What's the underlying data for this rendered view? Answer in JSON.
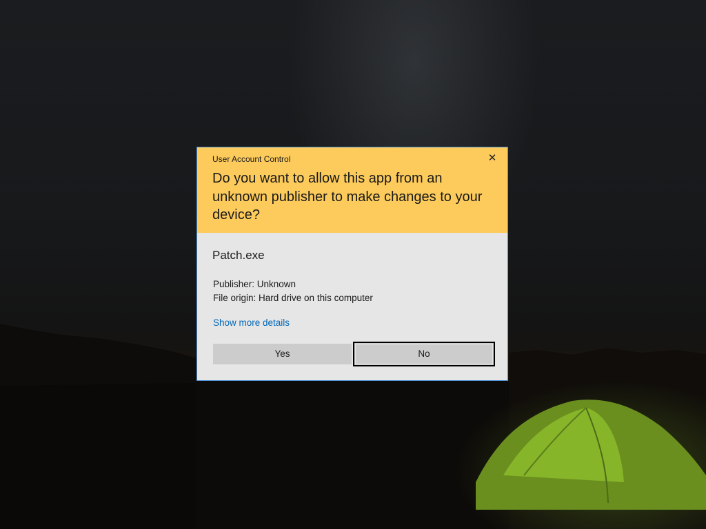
{
  "dialog": {
    "title": "User Account Control",
    "close_icon": "close-icon",
    "question": "Do you want to allow this app from an unknown publisher to make changes to your device?",
    "app_name": "Patch.exe",
    "publisher": "Publisher: Unknown",
    "file_origin": "File origin: Hard drive on this computer",
    "more_details_link": "Show more details",
    "yes_label": "Yes",
    "no_label": "No",
    "colors": {
      "header": "#fdcb5b",
      "body": "#e6e6e6",
      "link": "#0067b8",
      "border": "#4a8fd4"
    }
  }
}
